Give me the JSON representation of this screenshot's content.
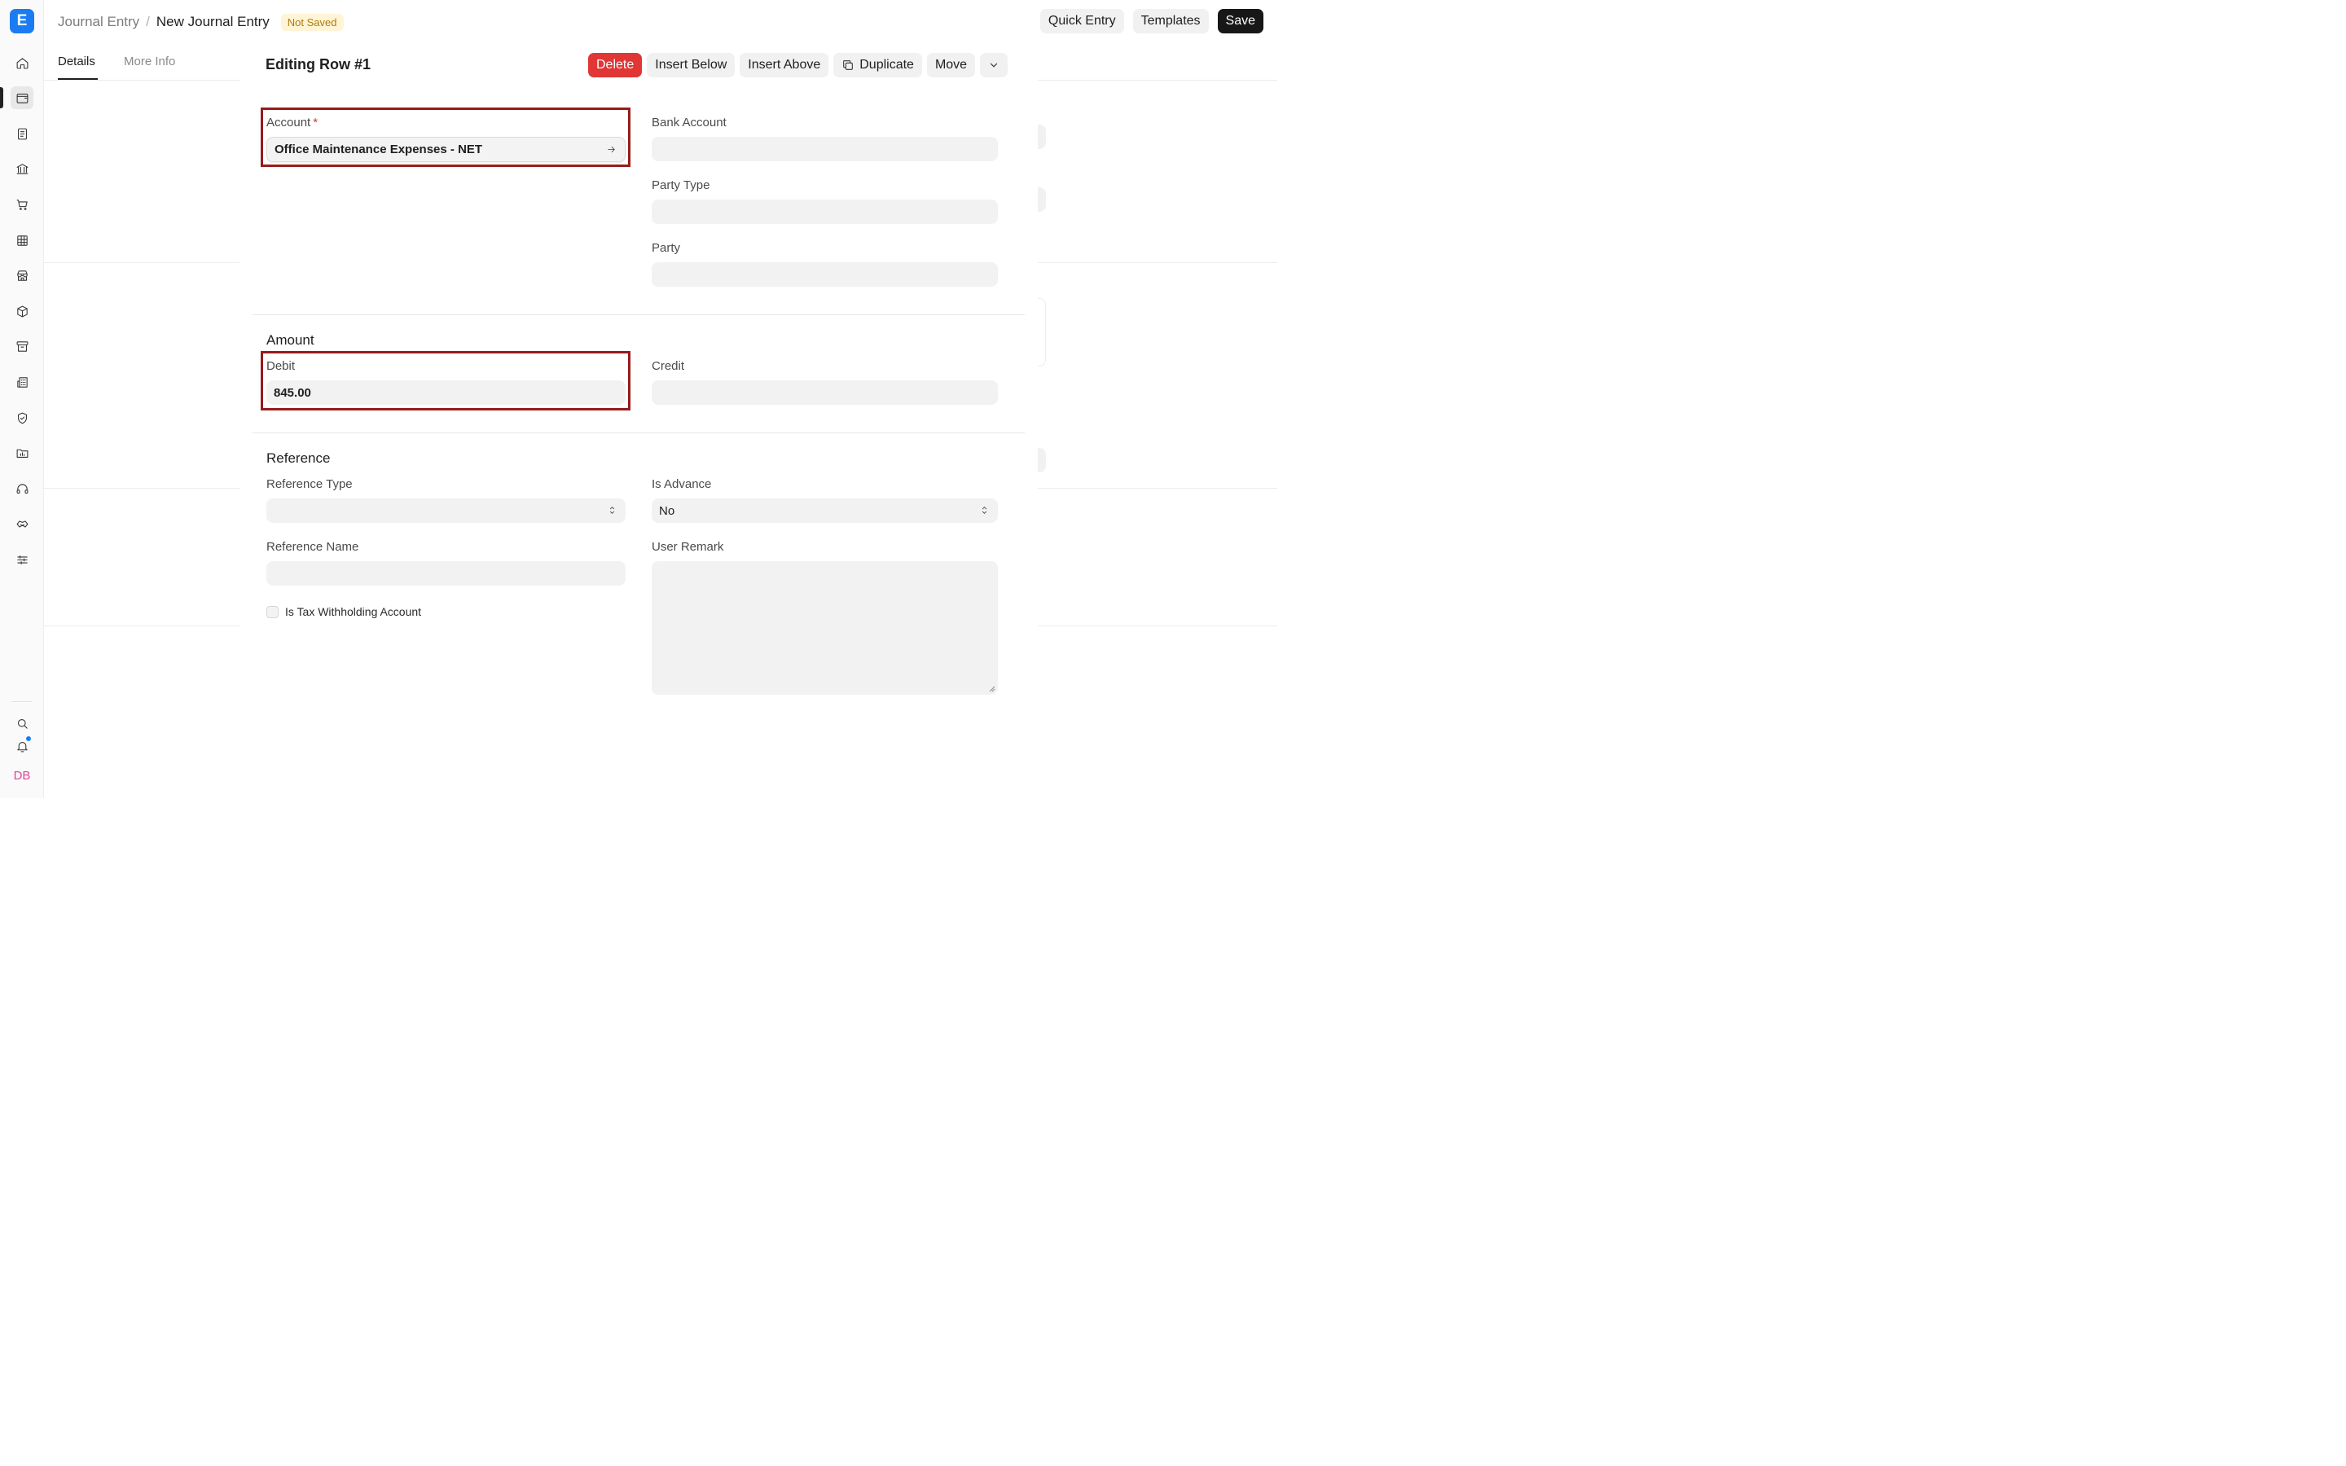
{
  "breadcrumb": {
    "parent": "Journal Entry",
    "separator": "/",
    "current": "New Journal Entry",
    "status": "Not Saved"
  },
  "top_actions": {
    "quick_entry": "Quick Entry",
    "templates": "Templates",
    "save": "Save"
  },
  "tabs": {
    "details": "Details",
    "more_info": "More Info"
  },
  "modal": {
    "title": "Editing Row #1",
    "actions": {
      "delete": "Delete",
      "insert_below": "Insert Below",
      "insert_above": "Insert Above",
      "duplicate": "Duplicate",
      "move": "Move"
    },
    "fields": {
      "account_label": "Account",
      "account_required": "*",
      "account_value": "Office Maintenance Expenses - NET",
      "bank_account_label": "Bank Account",
      "party_type_label": "Party Type",
      "party_label": "Party",
      "debit_label": "Debit",
      "debit_value": "845.00",
      "credit_label": "Credit",
      "reference_type_label": "Reference Type",
      "is_advance_label": "Is Advance",
      "is_advance_value": "No",
      "reference_name_label": "Reference Name",
      "user_remark_label": "User Remark",
      "tax_withholding_label": "Is Tax Withholding Account"
    },
    "sections": {
      "amount": "Amount",
      "reference": "Reference"
    }
  },
  "sidebar": {
    "logo": "E",
    "avatar": "DB"
  }
}
